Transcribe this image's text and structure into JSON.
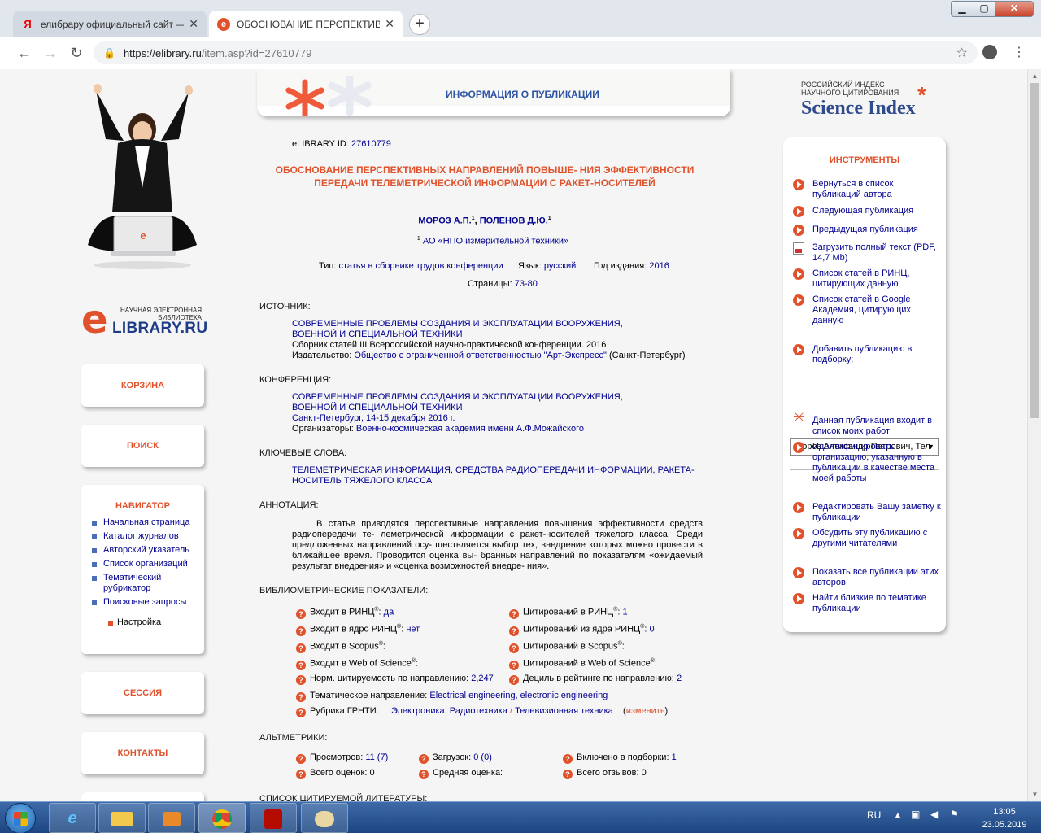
{
  "browser": {
    "tabs": [
      {
        "title": "елибрару официальный сайт — ",
        "favicon": "yandex-icon"
      },
      {
        "title": "ОБОСНОВАНИЕ ПЕРСПЕКТИВН",
        "favicon": "elibrary-icon"
      }
    ],
    "url_host": "https://elibrary.ru",
    "url_path": "/item.asp?id=27610779",
    "new_tab": "+"
  },
  "left": {
    "logo_caption": "НАУЧНАЯ ЭЛЕКТРОННАЯ БИБЛИОТЕКА",
    "logo_brand": "LIBRARY.RU",
    "cart": "КОРЗИНА",
    "search": "ПОИСК",
    "navigator": {
      "title": "НАВИГАТОР",
      "items": [
        "Начальная страница",
        "Каталог журналов",
        "Авторский указатель",
        "Список организаций",
        "Тематический рубрикатор",
        "Поисковые запросы"
      ],
      "settings": "Настройка"
    },
    "session": "СЕССИЯ",
    "contacts": "КОНТАКТЫ"
  },
  "header": {
    "title": "ИНФОРМАЦИЯ О ПУБЛИКАЦИИ"
  },
  "publication": {
    "id_label": "eLIBRARY ID:",
    "id_value": "27610779",
    "title": "ОБОСНОВАНИЕ ПЕРСПЕКТИВНЫХ НАПРАВЛЕНИЙ ПОВЫШЕ- НИЯ ЭФФЕКТИВНОСТИ ПЕРЕДАЧИ ТЕЛЕМЕТРИЧЕСКОЙ ИНФОРМАЦИИ С РАКЕТ-НОСИТЕЛЕЙ",
    "author1": "МОРОЗ А.П.",
    "author2": "ПОЛЕНОВ Д.Ю.",
    "sup1": "1",
    "affiliation": "АО «НПО измерительной техники»",
    "type_label": "Тип:",
    "type_value": "статья в сборнике трудов конференции",
    "lang_label": "Язык:",
    "lang_value": "русский",
    "year_label": "Год издания:",
    "year_value": "2016",
    "pages_label": "Страницы:",
    "pages_value": "73-80"
  },
  "source": {
    "label": "ИСТОЧНИК:",
    "title": "СОВРЕМЕННЫЕ ПРОБЛЕМЫ СОЗДАНИЯ И ЭКСПЛУАТАЦИИ ВООРУЖЕНИЯ, ВОЕННОЙ И СПЕЦИАЛЬНОЙ ТЕХНИКИ",
    "collection": "Сборник статей III Всероссийской научно-практической конференции. 2016",
    "publisher_label": "Издательство:",
    "publisher": "Общество с ограниченной ответственностью \"Арт-Экспресс\"",
    "publisher_city": "(Санкт-Петербург)"
  },
  "conference": {
    "label": "КОНФЕРЕНЦИЯ:",
    "title": "СОВРЕМЕННЫЕ ПРОБЛЕМЫ СОЗДАНИЯ И ЭКСПЛУАТАЦИИ ВООРУЖЕНИЯ, ВОЕННОЙ И СПЕЦИАЛЬНОЙ ТЕХНИКИ",
    "place": "Санкт-Петербург, 14-15 декабря 2016 г.",
    "org_label": "Организаторы:",
    "org": "Военно-космическая академия имени А.Ф.Можайского"
  },
  "keywords": {
    "label": "КЛЮЧЕВЫЕ СЛОВА:",
    "text": "ТЕЛЕМЕТРИЧЕСКАЯ ИНФОРМАЦИЯ, СРЕДСТВА РАДИОПЕРЕДАЧИ ИНФОРМАЦИИ, РАКЕТА-НОСИТЕЛЬ ТЯЖЕЛОГО КЛАССА"
  },
  "abstract": {
    "label": "АННОТАЦИЯ:",
    "text": "В статье приводятся перспективные направления повышения эффективности средств радиопередачи те- леметрической информации с ракет-носителей тяжелого класса. Среди предложенных направлений осу- ществляется выбор тех, внедрение которых можно провести в ближайшее время. Проводится оценка вы- бранных направлений по показателям «ожидаемый результат внедрения» и «оценка возможностей внедре- ния»."
  },
  "biblio": {
    "label": "БИБЛИОМЕТРИЧЕСКИЕ ПОКАЗАТЕЛИ:",
    "rinc_in": "Входит в РИНЦ",
    "rinc_in_val": "да",
    "core_in": "Входит в ядро РИНЦ",
    "core_in_val": "нет",
    "scopus_in": "Входит в Scopus",
    "wos_in": "Входит в Web of Science",
    "norm_cit": "Норм. цитируемость по направлению:",
    "norm_cit_val": "2,247",
    "rinc_cit": "Цитирований в РИНЦ",
    "rinc_cit_val": "1",
    "core_cit": "Цитирований из ядра РИНЦ",
    "core_cit_val": "0",
    "scopus_cit": "Цитирований в Scopus",
    "wos_cit": "Цитирований в Web of Science",
    "decile": "Дециль в рейтинге по направлению:",
    "decile_val": "2",
    "reg": "®",
    "thematic_label": "Тематическое направление:",
    "thematic": "Electrical engineering, electronic engineering",
    "grnti_label": "Рубрика ГРНТИ:",
    "grnti1": "Электроника. Радиотехника",
    "grnti_sep": "/",
    "grnti2": "Телевизионная техника",
    "change": "изменить"
  },
  "altmetrics": {
    "label": "АЛЬТМЕТРИКИ:",
    "views": "Просмотров:",
    "views_val": "11 (7)",
    "downloads": "Загрузок:",
    "downloads_val": "0 (0)",
    "included": "Включено в подборки:",
    "included_val": "1",
    "ratings": "Всего оценок:",
    "ratings_val": "0",
    "avg": "Средняя оценка:",
    "reviews": "Всего отзывов:",
    "reviews_val": "0"
  },
  "references_label": "СПИСОК ЦИТИРУЕМОЙ ЛИТЕРАТУРЫ:",
  "right": {
    "si_small": "РОССИЙСКИЙ ИНДЕКС НАУЧНОГО ЦИТИРОВАНИЯ",
    "si_big": "Science Index",
    "tools_title": "ИНСТРУМЕНТЫ",
    "tools": [
      "Вернуться в список публикаций автора",
      "Следующая публикация",
      "Предыдущая публикация",
      "Загрузить полный текст (PDF, 14,7 Mb)",
      "Список статей в РИНЦ, цитирующих данную",
      "Список статей в Google Академия, цитирующих данную",
      "Добавить публикацию в подборку:",
      "Данная публикация входит в список моих работ",
      "Идентифицировать организацию, указанную в публикации в качестве места моей работы",
      "Редактировать Вашу заметку к публикации",
      "Обсудить эту публикацию с другими читателями",
      "Показать все публикации этих авторов",
      "Найти близкие по тематике публикации"
    ],
    "select_value": "Мороз Александр Петрович, Тел"
  },
  "taskbar": {
    "lang": "RU",
    "time": "13:05",
    "date": "23.05.2019"
  }
}
